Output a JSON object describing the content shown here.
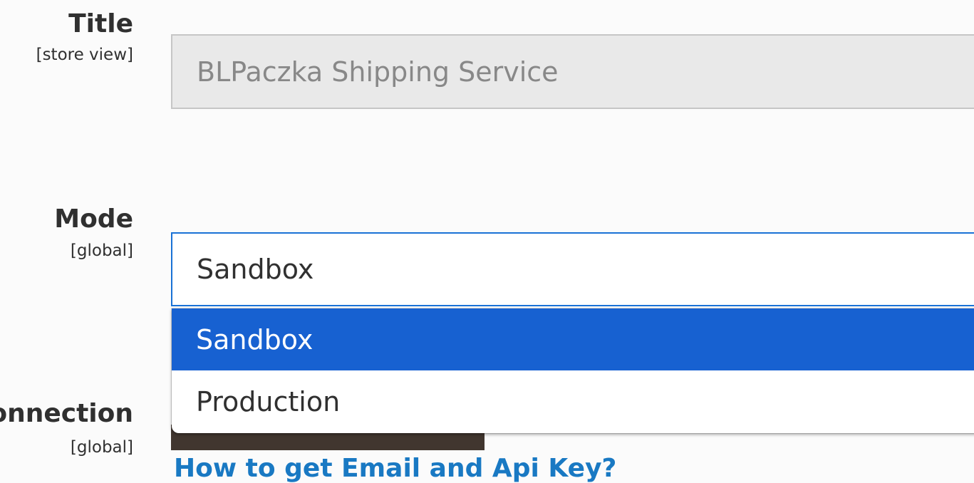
{
  "form": {
    "title": {
      "label": "Title",
      "scope": "[store view]",
      "value": "BLPaczka Shipping Service"
    },
    "mode": {
      "label": "Mode",
      "scope": "[global]",
      "selected": "Sandbox",
      "options": [
        "Sandbox",
        "Production"
      ]
    },
    "connection": {
      "label": "Connection",
      "scope": "[global]"
    },
    "help_link": "How to get Email and Api Key?"
  },
  "colors": {
    "accent": "#1a72d6",
    "selected_option": "#1761d1",
    "link": "#1979c3"
  }
}
